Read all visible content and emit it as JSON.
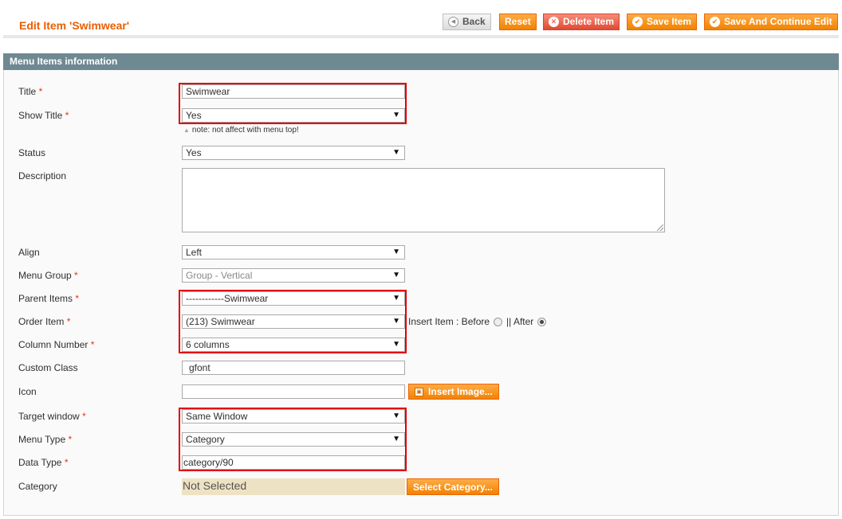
{
  "header": {
    "title": "Edit Item 'Swimwear'",
    "buttons": {
      "back": "Back",
      "reset": "Reset",
      "delete": "Delete Item",
      "save": "Save Item",
      "save_continue": "Save And Continue Edit"
    }
  },
  "fieldset": {
    "title": "Menu Items information"
  },
  "form": {
    "title": {
      "label": "Title",
      "value": "Swimwear"
    },
    "show_title": {
      "label": "Show Title",
      "value": "Yes",
      "note": "note: not affect with menu top!"
    },
    "status": {
      "label": "Status",
      "value": "Yes"
    },
    "description": {
      "label": "Description",
      "value": ""
    },
    "align": {
      "label": "Align",
      "value": "Left"
    },
    "menu_group": {
      "label": "Menu Group",
      "value": "Group - Vertical"
    },
    "parent_items": {
      "label": "Parent Items",
      "value": "------------Swimwear"
    },
    "order_item": {
      "label": "Order Item",
      "value": "(213) Swimwear"
    },
    "insert_item": {
      "label": "Insert Item : Before",
      "after_label": "|| After",
      "selected": "After"
    },
    "column_number": {
      "label": "Column Number",
      "value": "6 columns"
    },
    "custom_class": {
      "label": "Custom Class",
      "value": "gfont"
    },
    "icon": {
      "label": "Icon",
      "value": "",
      "button": "Insert Image..."
    },
    "target_window": {
      "label": "Target window",
      "value": "Same Window"
    },
    "menu_type": {
      "label": "Menu Type",
      "value": "Category"
    },
    "data_type": {
      "label": "Data Type",
      "value": "category/90"
    },
    "category": {
      "label": "Category",
      "value": "Not Selected",
      "button": "Select Category..."
    }
  },
  "required_marker": "*",
  "colors": {
    "accent_orange": "#eb5e00",
    "button_orange": "#f18200",
    "fieldset_header": "#6f8992",
    "highlight_red": "#e00000"
  }
}
